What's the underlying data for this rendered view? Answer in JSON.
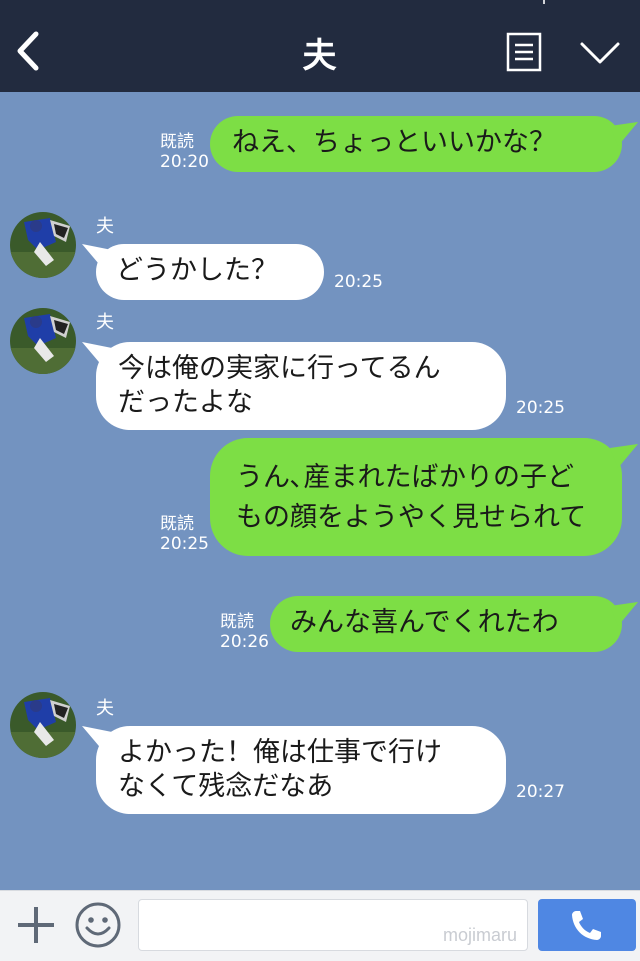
{
  "header": {
    "title": "夫",
    "back_icon": "chevron-left-icon",
    "notes_icon": "notes-menu-icon",
    "more_icon": "chevron-down-icon"
  },
  "messages": [
    {
      "side": "right",
      "text": "ねえ、ちょっといいかな？",
      "read": "既読",
      "time": "20:20"
    },
    {
      "side": "left",
      "sender": "夫",
      "text": "どうかした？",
      "time": "20:25"
    },
    {
      "side": "left",
      "sender": "夫",
      "lines": [
        "今は俺の実家に行ってるん",
        "だったよな"
      ],
      "time": "20:25"
    },
    {
      "side": "right",
      "lines": [
        "うん､産まれたばかりの子ど",
        "もの顔をようやく見せられて"
      ],
      "read": "既読",
      "time": "20:25"
    },
    {
      "side": "right",
      "text": "みんな喜んでくれたわ",
      "read": "既読",
      "time": "20:26"
    },
    {
      "side": "left",
      "sender": "夫",
      "lines": [
        "よかった！俺は仕事で行け",
        "なくて残念だなあ"
      ],
      "time": "20:27"
    }
  ],
  "footer": {
    "input_value": "",
    "watermark": "mojimaru",
    "plus_icon": "plus-icon",
    "emoji_icon": "smiley-icon",
    "call_icon": "phone-icon"
  },
  "colors": {
    "header_bg": "#222b3f",
    "chat_bg": "#7393c0",
    "my_bubble": "#7dde45",
    "their_bubble": "#ffffff",
    "call_button": "#4f87e3"
  }
}
